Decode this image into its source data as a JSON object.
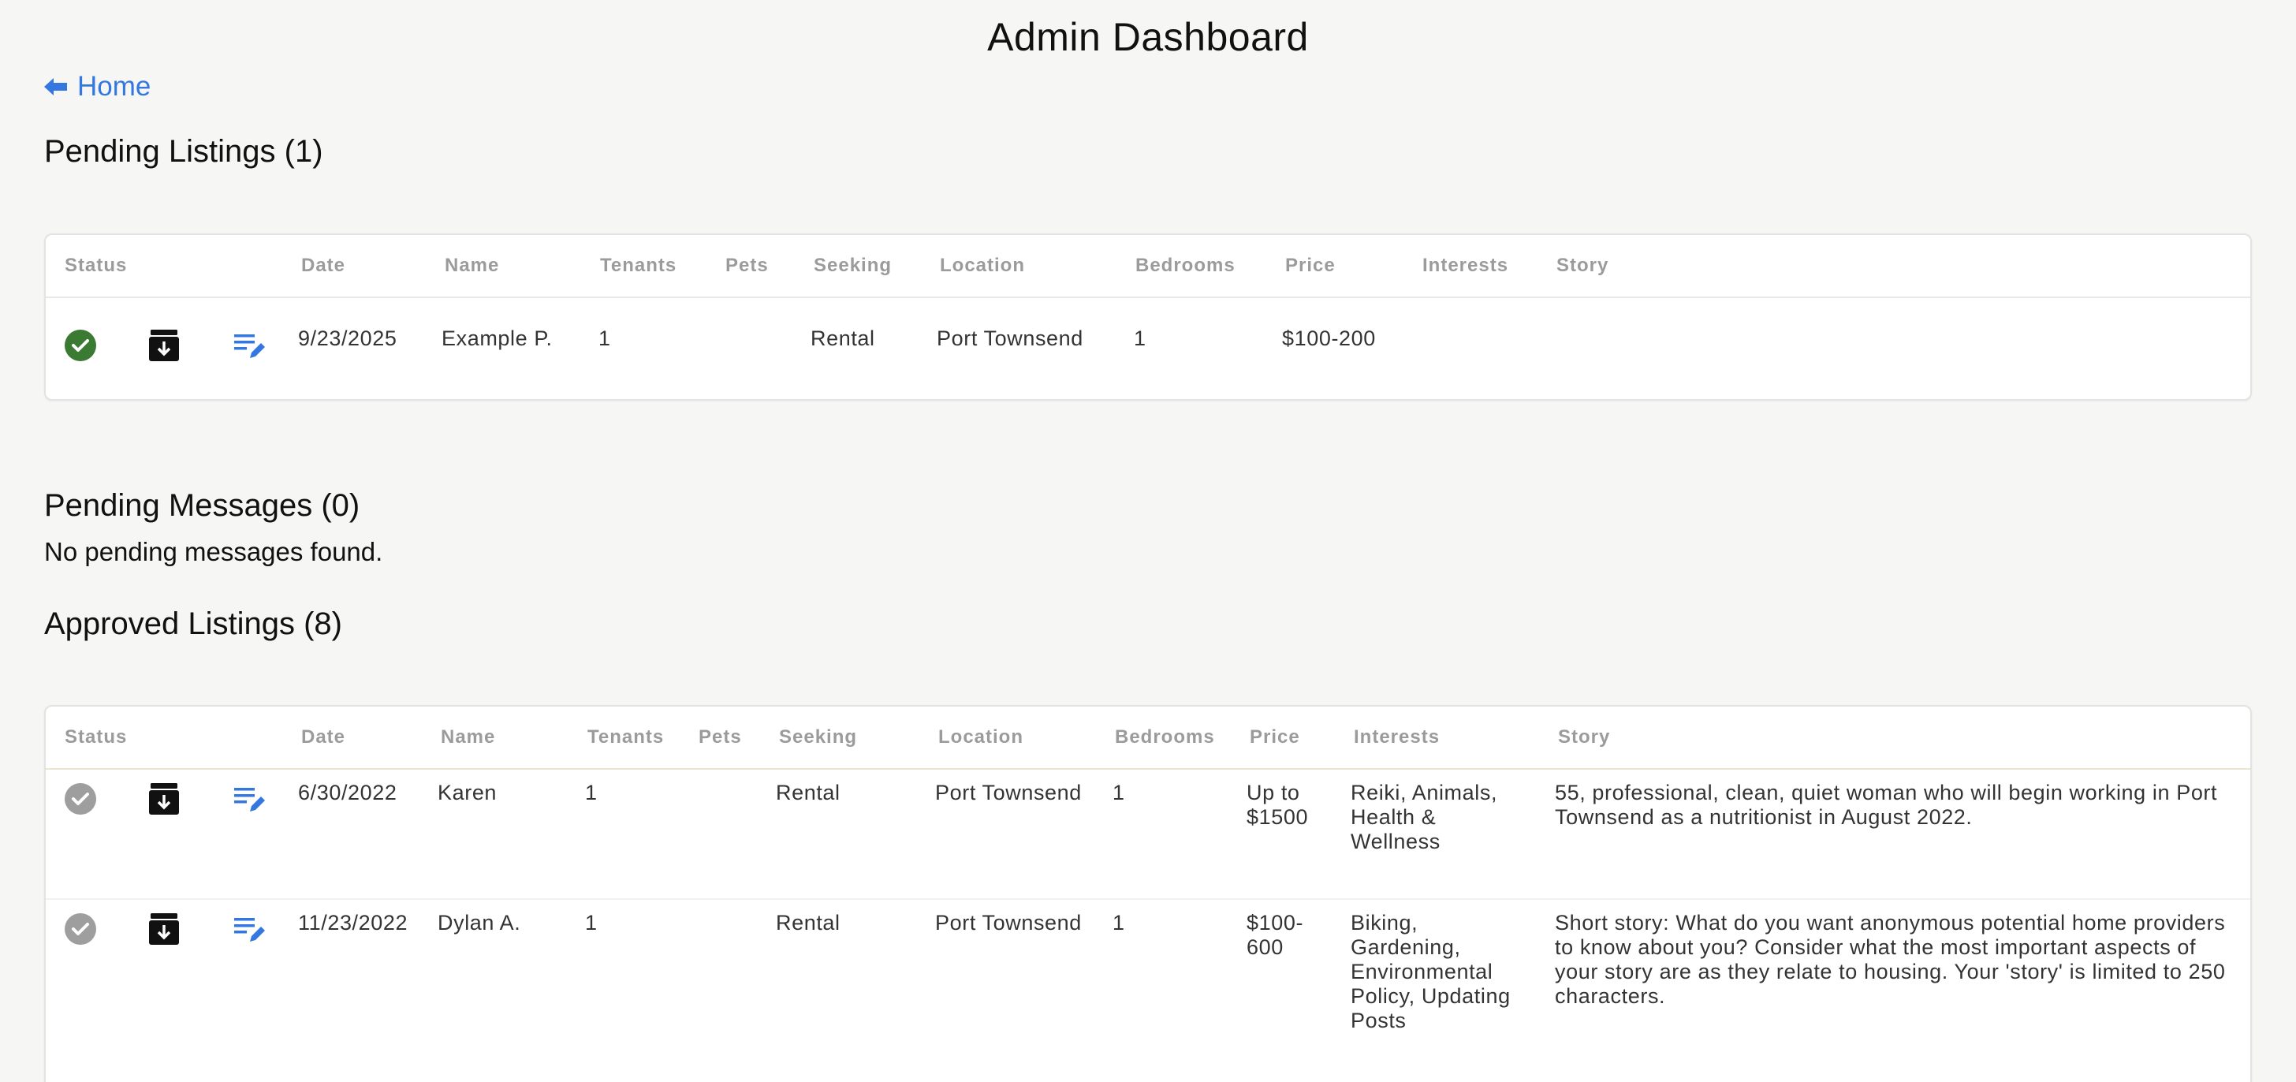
{
  "header": {
    "title": "Admin Dashboard",
    "home_label": "Home"
  },
  "pending_listings": {
    "heading": "Pending Listings (1)",
    "columns": [
      "Status",
      "Date",
      "Name",
      "Tenants",
      "Pets",
      "Seeking",
      "Location",
      "Bedrooms",
      "Price",
      "Interests",
      "Story"
    ],
    "rows": [
      {
        "date": "9/23/2025",
        "name": "Example P.",
        "tenants": "1",
        "pets": "",
        "seeking": "Rental",
        "location": "Port Townsend",
        "bedrooms": "1",
        "price": "$100-200",
        "interests": "",
        "story": ""
      }
    ]
  },
  "pending_messages": {
    "heading": "Pending Messages (0)",
    "empty_text": "No pending messages found."
  },
  "approved_listings": {
    "heading": "Approved Listings (8)",
    "columns": [
      "Status",
      "Date",
      "Name",
      "Tenants",
      "Pets",
      "Seeking",
      "Location",
      "Bedrooms",
      "Price",
      "Interests",
      "Story"
    ],
    "rows": [
      {
        "date": "6/30/2022",
        "name": "Karen",
        "tenants": "1",
        "pets": "",
        "seeking": "Rental",
        "location": "Port Townsend",
        "bedrooms": "1",
        "price": "Up to $1500",
        "interests": "Reiki, Animals, Health & Wellness",
        "story": "55, professional, clean, quiet woman who will begin working in Port Townsend as a nutritionist in August 2022."
      },
      {
        "date": "11/23/2022",
        "name": "Dylan A.",
        "tenants": "1",
        "pets": "",
        "seeking": "Rental",
        "location": "Port Townsend",
        "bedrooms": "1",
        "price": "$100-600",
        "interests": "Biking, Gardening, Environmental Policy, Updating Posts",
        "story": "Short story: What do you want anonymous potential home providers to know about you? Consider what the most important aspects of your story are as they relate to housing. Your 'story' is limited to 250 characters."
      }
    ]
  },
  "colors": {
    "link_blue": "#3477e0",
    "approved_green": "#3a7a32",
    "status_gray": "#9e9e9e",
    "header_gray": "#9b9b9b"
  },
  "icons": {
    "approve": "check-circle-icon",
    "archive": "archive-download-icon",
    "edit": "edit-notes-icon",
    "back": "arrow-left-icon"
  }
}
